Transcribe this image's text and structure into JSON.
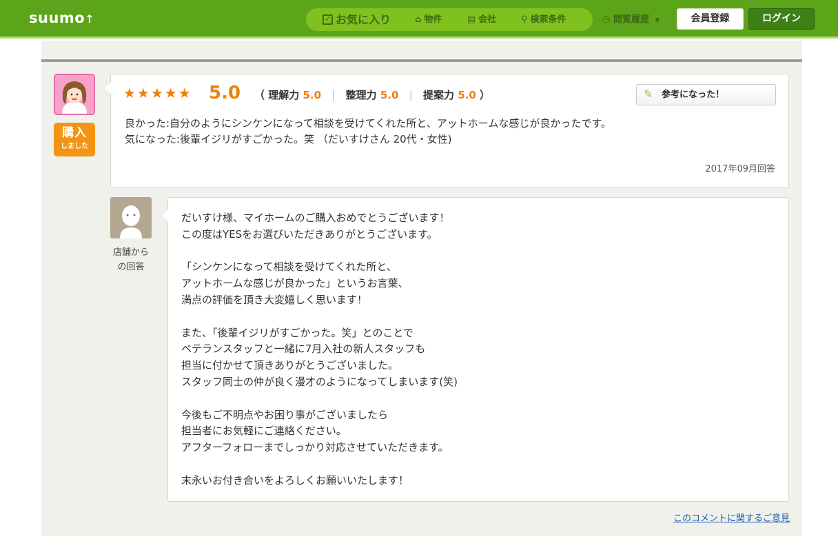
{
  "header": {
    "logo": "suumo",
    "nav": {
      "favorites": "お気に入り",
      "properties": "物件",
      "companies": "会社",
      "search_conditions": "検索条件"
    },
    "history": "閲覧履歴",
    "register": "会員登録",
    "login": "ログイン"
  },
  "review": {
    "stars": "★★★★★",
    "score": "5.0",
    "sub_scores": [
      {
        "label": "理解力",
        "value": "5.0"
      },
      {
        "label": "整理力",
        "value": "5.0"
      },
      {
        "label": "提案力",
        "value": "5.0"
      }
    ],
    "helpful_label": "参考になった！",
    "badge_big": "購入",
    "badge_small": "しました",
    "text": "良かった:自分のようにシンケンになって相談を受けてくれた所と、アットホームな感じが良かったです。\n気になった:後輩イジリがすごかった。笑 （だいすけさん 20代・女性)",
    "date": "2017年09月回答"
  },
  "reply": {
    "store_label": "店舗から\nの回答",
    "paragraphs": [
      "だいすけ様、マイホームのご購入おめでとうございます！\nこの度はYESをお選びいただきありがとうございます。",
      "「シンケンになって相談を受けてくれた所と、\nアットホームな感じが良かった」というお言葉、\n満点の評価を頂き大変嬉しく思います！",
      "また、「後輩イジリがすごかった。笑」とのことで\nベテランスタッフと一緒に7月入社の新人スタッフも\n担当に付かせて頂きありがとうございました。\nスタッフ同士の仲が良く漫才のようになってしまいます(笑)",
      "今後もご不明点やお困り事がございましたら\n担当者にお気軽にご連絡ください。\nアフターフォローまでしっかり対応させていただきます。",
      "末永いお付き合いをよろしくお願いいたします！"
    ]
  },
  "feedback_link": "このコメントに関するご意見",
  "colors": {
    "header_green": "#5ca41a",
    "nav_pill": "#7fc21f",
    "accent_orange": "#f0800a",
    "login_green": "#3d8016"
  }
}
